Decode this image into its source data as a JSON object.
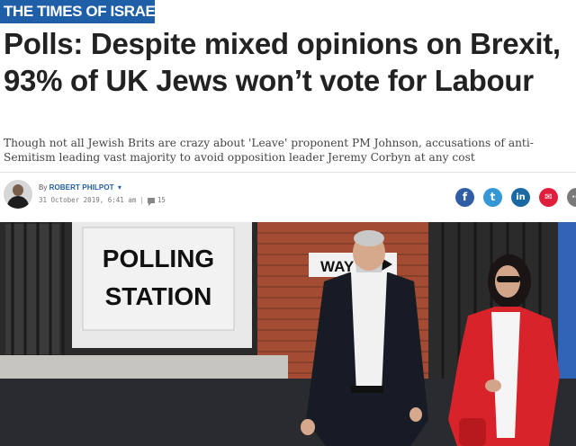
{
  "masthead": {
    "logo_text": "THE TIMES OF ISRAEL",
    "brand_color": "#1f5fa8"
  },
  "article": {
    "headline": "Polls: Despite mixed opinions on Brexit, 93% of UK Jews won’t vote for Labour",
    "subhead": "Though not all Jewish Brits are crazy about 'Leave' proponent PM Johnson, accusations of anti-Semitism leading vast majority to avoid opposition leader Jeremy Corbyn at any cost"
  },
  "byline": {
    "prefix": "By",
    "author": "ROBERT PHILPOT",
    "date_time": "31 October 2019, 6:41 am",
    "separator": "|",
    "comments": "15"
  },
  "share": {
    "facebook_glyph": "f",
    "twitter_glyph": "t",
    "linkedin_glyph": "in",
    "email_glyph": "✉",
    "more_glyph": "⋯"
  },
  "photo": {
    "sign_line1": "POLLING",
    "sign_line2": "STATION",
    "way_sign": "WAY"
  }
}
